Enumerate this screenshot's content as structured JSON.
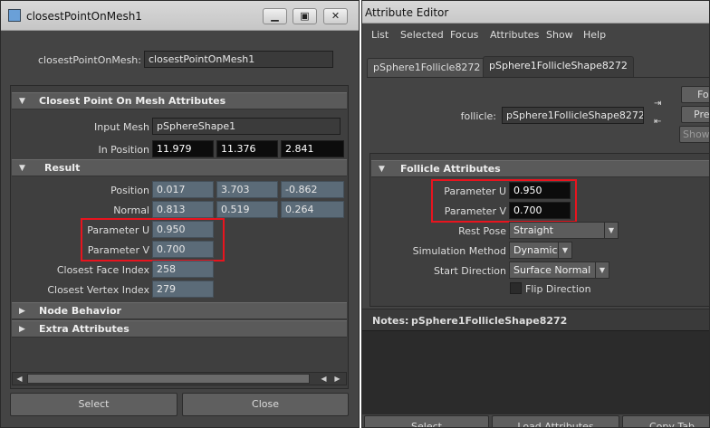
{
  "left_window": {
    "title": "closestPointOnMesh1",
    "window_buttons": [
      "▁",
      "▣",
      "✕"
    ],
    "node_label": "closestPointOnMesh:",
    "node_value": "closestPointOnMesh1",
    "section_main": "Closest Point On Mesh Attributes",
    "input_mesh_label": "Input Mesh",
    "input_mesh_value": "pSphereShape1",
    "in_position_label": "In Position",
    "in_position": [
      "11.979",
      "11.376",
      "2.841"
    ],
    "result_section": "Result",
    "position_label": "Position",
    "position": [
      "0.017",
      "3.703",
      "-0.862"
    ],
    "normal_label": "Normal",
    "normal": [
      "0.813",
      "0.519",
      "0.264"
    ],
    "param_u_label": "Parameter U",
    "param_u": "0.950",
    "param_v_label": "Parameter V",
    "param_v": "0.700",
    "face_index_label": "Closest Face Index",
    "face_index": "258",
    "vertex_index_label": "Closest Vertex Index",
    "vertex_index": "279",
    "node_behavior": "Node Behavior",
    "extra_attributes": "Extra Attributes",
    "select_button": "Select",
    "close_button": "Close"
  },
  "right_window": {
    "title": "Attribute Editor",
    "menu": [
      "List",
      "Selected",
      "Focus",
      "Attributes",
      "Show",
      "Help"
    ],
    "tabs": [
      "pSphere1Follicle8272",
      "pSphere1FollicleShape8272"
    ],
    "node_label": "follicle:",
    "node_value": "pSphere1FollicleShape8272",
    "side_buttons": [
      "Fo",
      "Pre",
      "Show"
    ],
    "section": "Follicle Attributes",
    "param_u_label": "Parameter U",
    "param_u": "0.950",
    "param_v_label": "Parameter V",
    "param_v": "0.700",
    "rest_pose_label": "Rest Pose",
    "rest_pose": "Straight",
    "sim_method_label": "Simulation Method",
    "sim_method": "Dynamic",
    "start_dir_label": "Start Direction",
    "start_dir": "Surface Normal",
    "flip_direction": "Flip Direction",
    "notes_label": "Notes:",
    "notes_value": "pSphere1FollicleShape8272",
    "bottom_buttons": [
      "Select",
      "Load Attributes",
      "Copy Tab"
    ]
  }
}
